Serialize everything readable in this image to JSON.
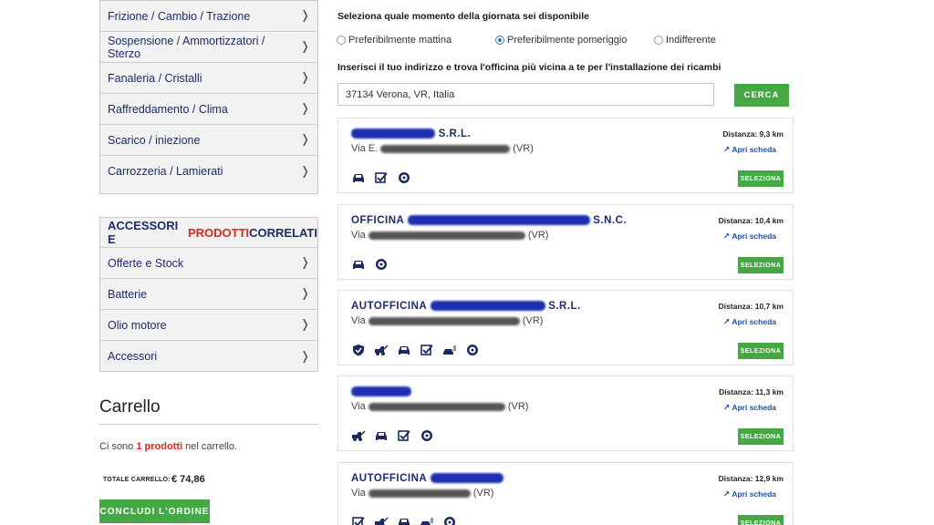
{
  "categories": [
    {
      "label": "Frizione / Cambio / Trazione"
    },
    {
      "label": "Sospensione / Ammortizzatori / Sterzo"
    },
    {
      "label": "Fanaleria / Cristalli"
    },
    {
      "label": "Raffreddamento / Clima"
    },
    {
      "label": "Scarico / iniezione"
    },
    {
      "label": "Carrozzeria / Lamierati"
    }
  ],
  "accessories": {
    "title_part1": "ACCESSORI E ",
    "title_part2": "PRODOTTI",
    "title_part3": " CORRELATI",
    "items": [
      {
        "label": "Offerte e Stock"
      },
      {
        "label": "Batterie"
      },
      {
        "label": "Olio motore"
      },
      {
        "label": "Accessori"
      }
    ]
  },
  "cart": {
    "title": "Carrello",
    "count_prefix": "Ci sono ",
    "count_value": "1 prodotti",
    "count_suffix": " nel carrello.",
    "total_label": "TOTALE CARRELLO:",
    "total_value": "€ 74,86",
    "checkout_label": "CONCLUDI L'ORDINE"
  },
  "availability": {
    "question": "Seleziona quale momento della giornata sei disponibile",
    "options": [
      "Preferibilmente mattina",
      "Preferibilmente pomeriggio",
      "Indifferente"
    ],
    "selected": "Preferibilmente pomeriggio"
  },
  "address": {
    "question": "Inserisci il tuo indirizzo e trova l'officina più vicina a te per l'installazione dei ricambi",
    "value": "37134 Verona, VR, Italia",
    "search_label": "CERCA"
  },
  "shops": [
    {
      "name_suffix": " S.R.L.",
      "addr_prefix": "Via E. ",
      "addr_suffix": " (VR)",
      "distance": "Distanza: 9,3 km",
      "open_label": "Apri scheda",
      "select_label": "SELEZIONA",
      "icons": [
        "car-icon",
        "checkbox-icon",
        "wheel-icon"
      ]
    },
    {
      "name_prefix": "OFFICINA ",
      "name_suffix": " S.N.C.",
      "addr_prefix": "Via ",
      "addr_suffix": " (VR)",
      "distance": "Distanza: 10,4 km",
      "open_label": "Apri scheda",
      "select_label": "SELEZIONA",
      "icons": [
        "car-icon",
        "wheel-icon"
      ]
    },
    {
      "name_prefix": "AUTOFFICINA ",
      "name_suffix": " S.R.L.",
      "addr_prefix": "Via ",
      "addr_suffix": " (VR)",
      "distance": "Distanza: 10,7 km",
      "open_label": "Apri scheda",
      "select_label": "SELEZIONA",
      "icons": [
        "shield-icon",
        "tow-truck-icon",
        "car-icon",
        "checkbox-icon",
        "car-wash-icon",
        "wheel-icon"
      ]
    },
    {
      "addr_prefix": "Via ",
      "addr_suffix": " (VR)",
      "distance": "Distanza: 11,3 km",
      "open_label": "Apri scheda",
      "select_label": "SELEZIONA",
      "icons": [
        "tow-truck-icon",
        "car-icon",
        "checkbox-icon",
        "wheel-icon"
      ]
    },
    {
      "name_prefix": "AUTOFFICINA ",
      "addr_prefix": "Via ",
      "addr_suffix": " (VR)",
      "distance": "Distanza: 12,9 km",
      "open_label": "Apri scheda",
      "select_label": "SELEZIONA",
      "icons": [
        "checkbox-icon",
        "tow-truck-icon",
        "car-icon",
        "car-wash-icon",
        "wheel-icon"
      ]
    }
  ],
  "colors": {
    "accent_green": "#46a845",
    "brand_navy": "#1d2b6b",
    "highlight_red": "#e0261d"
  }
}
